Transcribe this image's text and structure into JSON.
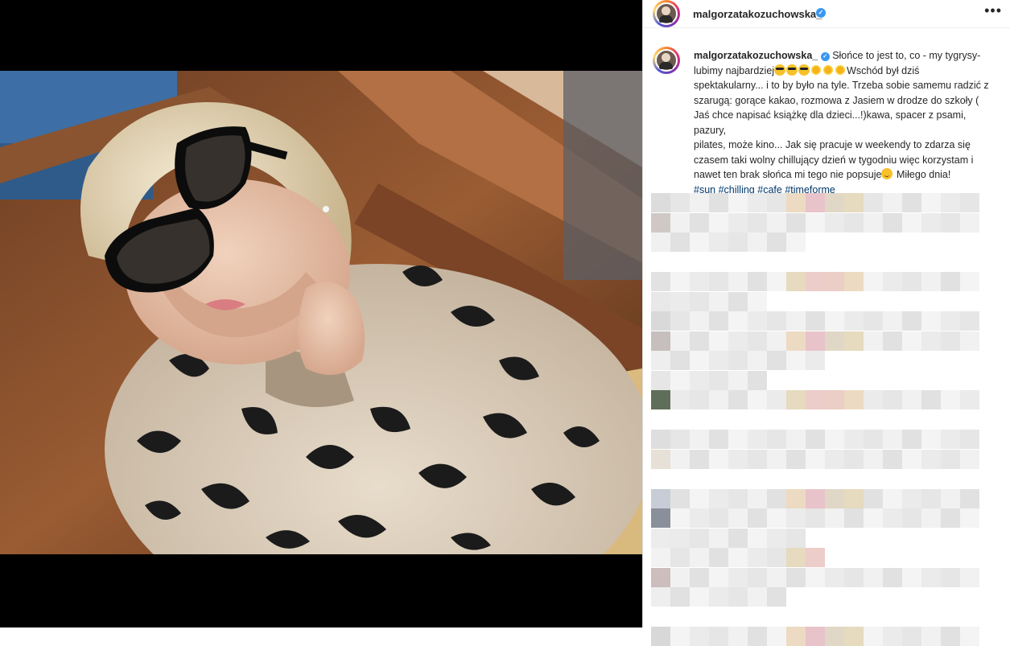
{
  "post": {
    "username": "malgorzatakozuchowska_",
    "more_label": "•••",
    "verified_mark": "✓"
  },
  "caption": {
    "username": "malgorzatakozuchowska_",
    "line1": "Słońce to jest to, co - my tygrysy-",
    "line2a": "lubimy najbardziej",
    "line2b": "Wschód był dziś",
    "line3": "spektakularny... i to by było na tyle. Trzeba sobie samemu radzić z",
    "line4": "szarugą: gorące kakao, rozmowa z Jasiem w drodze do szkoły (",
    "line5": "Jaś chce napisać książkę dla dzieci...!)kawa, spacer z psami, pazury,",
    "line6": "pilates, może kino... Jak się pracuje w weekendy to zdarza się",
    "line7": "czasem taki wolny chillujący dzień w tygodniu więc korzystam i",
    "line8a": "nawet ten brak słońca mi tego nie popsuje",
    "line8b": " Miłego dnia!",
    "hashtags": [
      "#sun",
      "#chilling",
      "#cafe",
      "#timeforme"
    ]
  },
  "icons": {
    "verified": "verified-badge-icon",
    "cool_face": "smiling-face-with-sunglasses-icon",
    "sun": "sun-icon",
    "smile": "smiling-face-icon"
  }
}
